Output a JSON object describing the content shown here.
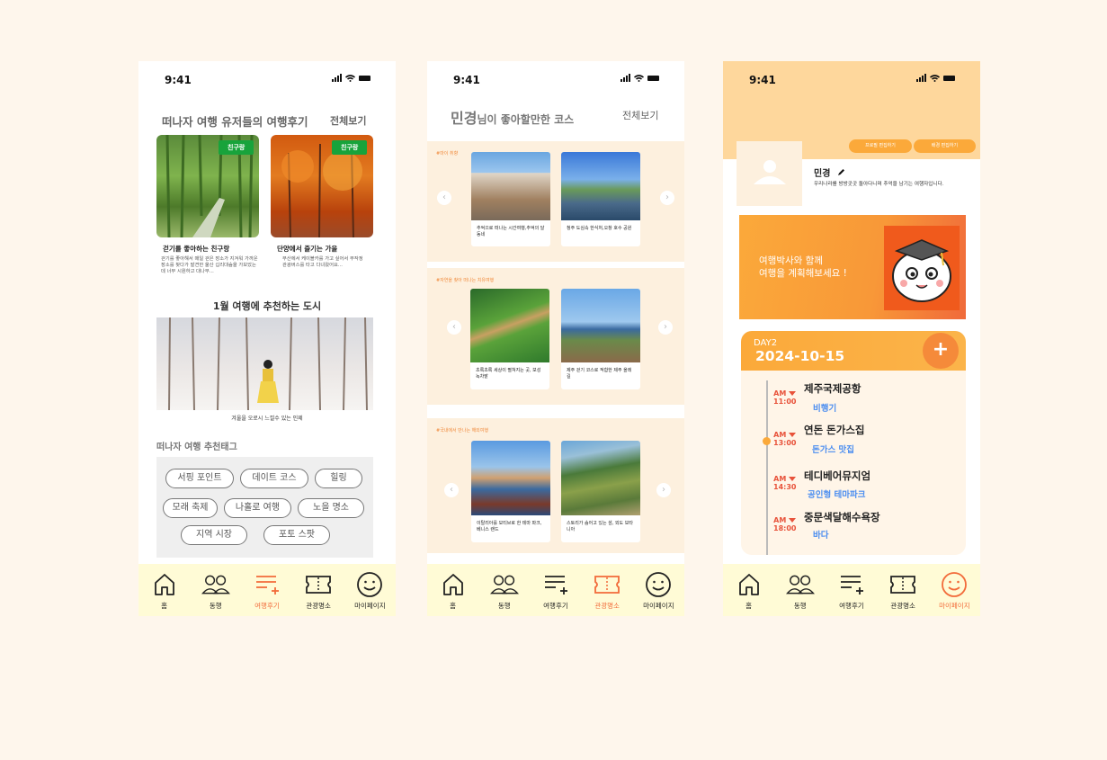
{
  "status": {
    "time": "9:41"
  },
  "tabs": [
    {
      "label": "홈",
      "icon": "home-icon"
    },
    {
      "label": "동행",
      "icon": "people-icon"
    },
    {
      "label": "여행후기",
      "icon": "list-add-icon"
    },
    {
      "label": "관광명소",
      "icon": "ticket-icon"
    },
    {
      "label": "마이페이지",
      "icon": "smile-icon"
    }
  ],
  "screen1": {
    "section_title": "떠나자 여행 유저들의 여행후기",
    "see_all": "전체보기",
    "reviews": [
      {
        "badge": "친구랑",
        "title": "걷기를 좋아하는 친구랑",
        "desc": "걷기를 좋아해서 매일 걷은 장소가 지겨워 가까운 장소를 찾다가 발견한 울산 십리대숲을 가보았는데 너무 시원하고 대나무..."
      },
      {
        "badge": "친구랑",
        "title": "단양에서 즐기는 가을",
        "desc": "부산에서 케이블카를 가고 싶어서 무작정 관광버스를 타고 다녀왔어요..."
      }
    ],
    "city_title": "1월 여행에 추천하는 도시",
    "city_caption": "겨울을 오로시 느낄수 있는 인제",
    "tags_title": "떠나자 여행 추천태그",
    "tags": [
      "서핑 포인트",
      "데이트 코스",
      "힐링",
      "모래 축제",
      "나홀로 여행",
      "노을 명소",
      "지역 시장",
      "포토 스팟"
    ]
  },
  "screen2": {
    "name": "민경",
    "title_suffix": "님이 좋아할만한 코스",
    "see_all": "전체보기",
    "sections": [
      {
        "label": "#마이 취향",
        "cards": [
          "추억으로 떠나는 시간여행,추억의 달동네",
          "청주 도심속 한식처,오창 호수 공원"
        ]
      },
      {
        "label": "#자연을 찾아 떠나는 치유여행",
        "cards": [
          "초록초록 세상이 펼쳐지는 곳, 보성 녹차밭",
          "제주 걷기 코스로 적합한 제주 올레길"
        ]
      },
      {
        "label": "#국내에서 만나는 해외여행",
        "cards": [
          "이탈리아를 모티브로 한 테마 파크,베니스 랜드",
          "스토리가 숨어고 있는 섬, 외도 보타니아"
        ]
      }
    ]
  },
  "screen3": {
    "btn_profile": "프로필 편집하기",
    "btn_bg": "배경 편집하기",
    "name": "민경",
    "bio": "우리나라를 방방곳곳 돌아다니며 추억을 남기는 여행자입니다.",
    "banner_line1": "여행박사와 함께",
    "banner_line2": "여행을 계획해보세요 !",
    "day": "DAY2",
    "date": "2024-10-15",
    "add": "+",
    "schedule": [
      {
        "ampm": "AM",
        "time": "11:00",
        "place": "제주국제공항",
        "category": "비행기"
      },
      {
        "ampm": "AM",
        "time": "13:00",
        "place": "연돈 돈가스집",
        "category": "돈가스 맛집"
      },
      {
        "ampm": "AM",
        "time": "14:30",
        "place": "테디베어뮤지엄",
        "category": "공인형 테마파크"
      },
      {
        "ampm": "AM",
        "time": "18:00",
        "place": "중문색달해수욕장",
        "category": "바다"
      }
    ]
  }
}
